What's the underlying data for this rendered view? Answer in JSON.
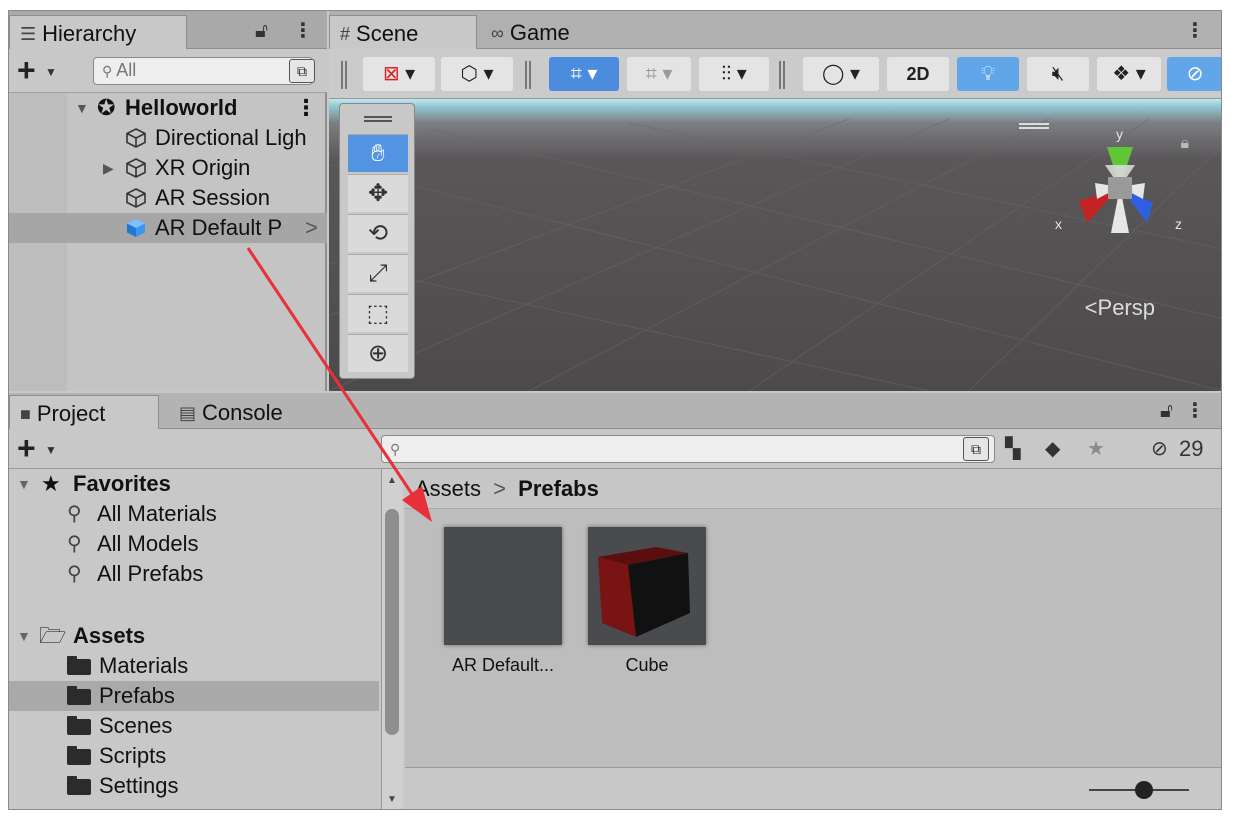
{
  "hierarchy": {
    "tab_label": "Hierarchy",
    "search_placeholder": "All",
    "root": "Helloworld",
    "items": [
      {
        "label": "Directional Ligh"
      },
      {
        "label": "XR Origin"
      },
      {
        "label": "AR Session"
      },
      {
        "label": "AR Default P"
      }
    ]
  },
  "scene": {
    "tabs": [
      {
        "label": "Scene"
      },
      {
        "label": "Game"
      }
    ],
    "toolbar": {
      "mode_2d": "2D"
    },
    "view_label": "Persp",
    "gizmo": {
      "x": "x",
      "y": "y",
      "z": "z"
    }
  },
  "project": {
    "tabs": [
      {
        "label": "Project"
      },
      {
        "label": "Console"
      }
    ],
    "hidden_count": "29",
    "favorites": {
      "label": "Favorites",
      "items": [
        {
          "label": "All Materials"
        },
        {
          "label": "All Models"
        },
        {
          "label": "All Prefabs"
        }
      ]
    },
    "assets": {
      "label": "Assets",
      "folders": [
        {
          "label": "Materials"
        },
        {
          "label": "Prefabs"
        },
        {
          "label": "Scenes"
        },
        {
          "label": "Scripts"
        },
        {
          "label": "Settings"
        }
      ]
    },
    "breadcrumb": {
      "root": "Assets",
      "current": "Prefabs"
    },
    "grid_items": [
      {
        "label": "AR Default..."
      },
      {
        "label": "Cube"
      }
    ]
  },
  "colors": {
    "accent_blue": "#4c8cdc",
    "arrow_red": "#e8303a",
    "gizmo_x": "#c22323",
    "gizmo_y": "#5fc635",
    "gizmo_z": "#2f5ee0",
    "cube_red": "#7a1414"
  }
}
